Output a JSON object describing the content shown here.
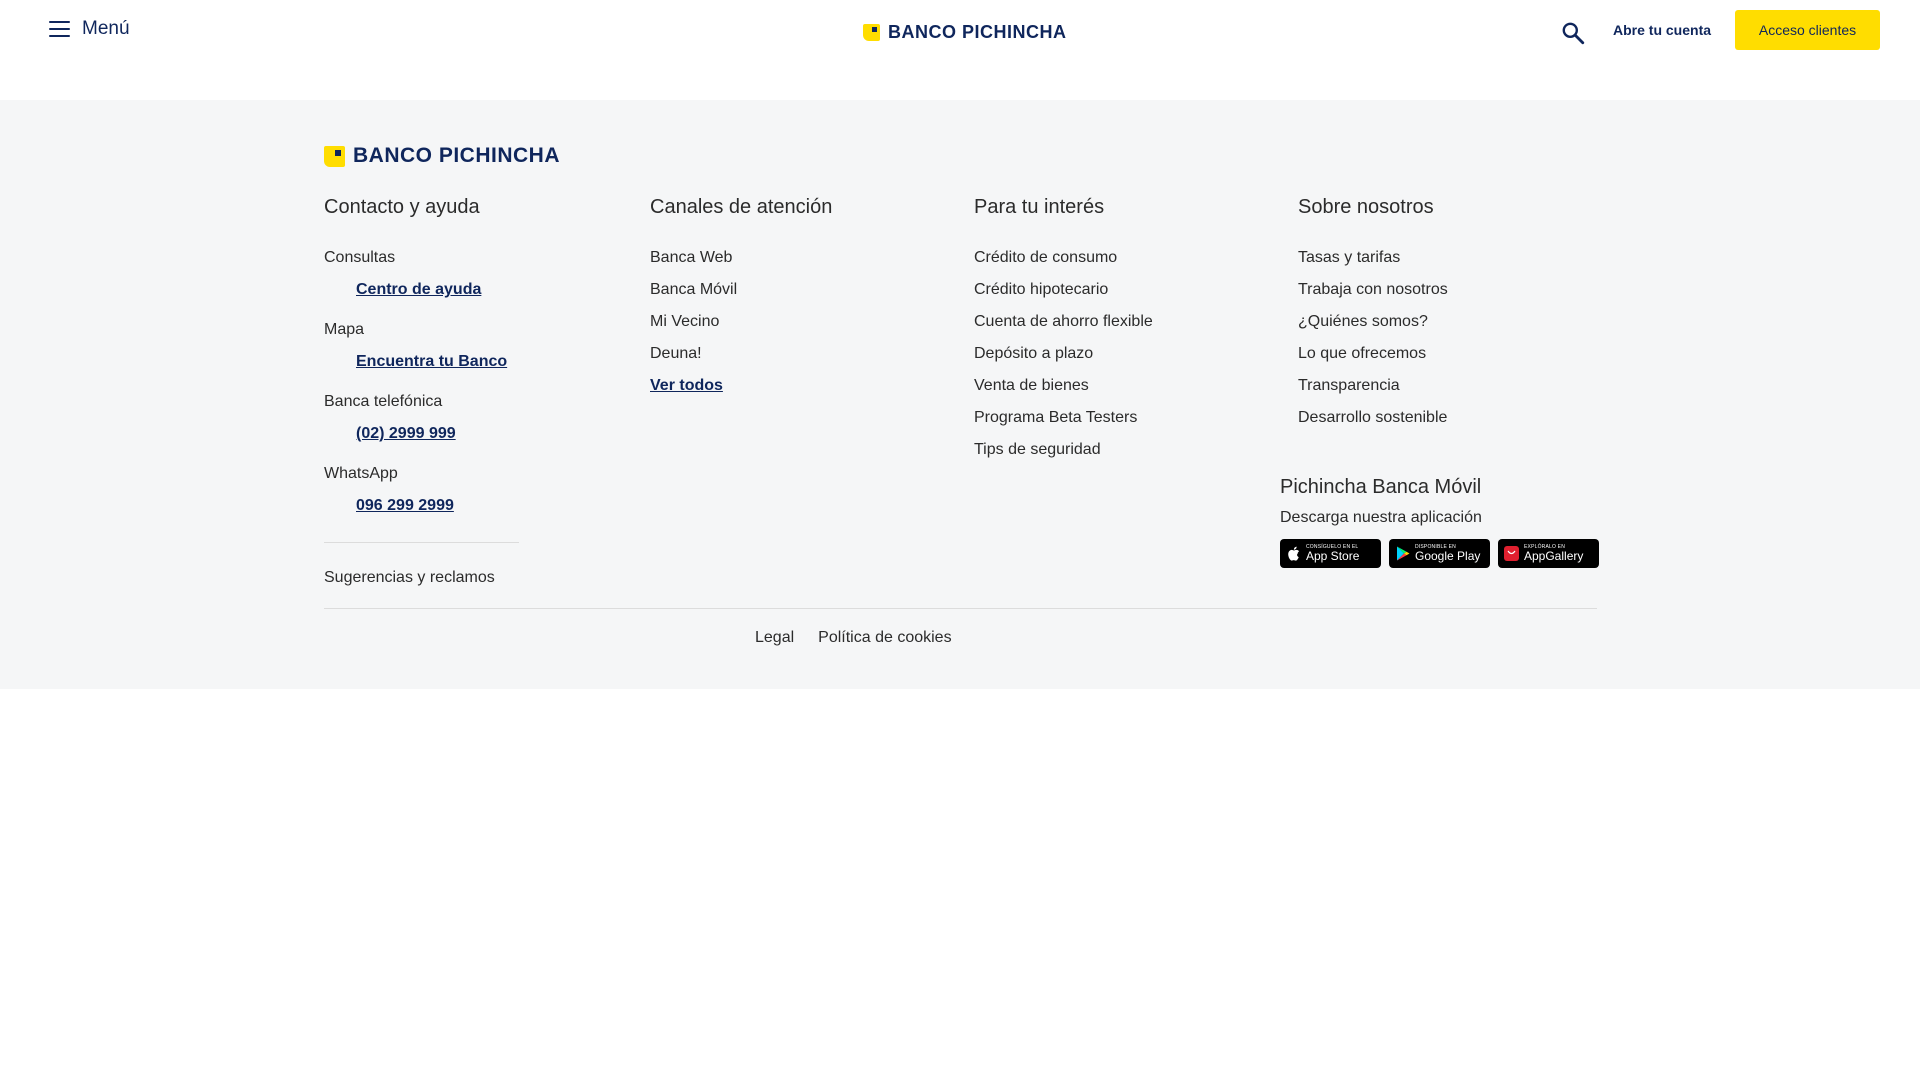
{
  "header": {
    "menu_label": "Menú",
    "logo_text": "BANCO PICHINCHA",
    "open_account": "Abre tu cuenta",
    "access_clients": "Acceso clientes"
  },
  "footer": {
    "logo_text": "BANCO PICHINCHA",
    "contact": {
      "title": "Contacto y ayuda",
      "groups": [
        {
          "label": "Consultas",
          "link": "Centro de ayuda"
        },
        {
          "label": "Mapa",
          "link": "Encuentra tu Banco"
        },
        {
          "label": "Banca telefónica",
          "link": "(02) 2999 999"
        },
        {
          "label": "WhatsApp",
          "link": "096 299 2999"
        }
      ],
      "suggestions": "Sugerencias y reclamos"
    },
    "channels": {
      "title": "Canales de atención",
      "items": [
        "Banca Web",
        "Banca Móvil",
        "Mi Vecino",
        "Deuna!"
      ],
      "see_all": "Ver todos"
    },
    "interest": {
      "title": "Para tu interés",
      "items": [
        "Crédito de consumo",
        "Crédito hipotecario",
        "Cuenta de ahorro flexible",
        "Depósito a plazo",
        "Venta de bienes",
        "Programa Beta Testers",
        "Tips de seguridad"
      ]
    },
    "about": {
      "title": "Sobre nosotros",
      "items": [
        "Tasas y tarifas",
        "Trabaja con nosotros",
        "¿Quiénes somos?",
        "Lo que ofrecemos",
        "Transparencia",
        "Desarrollo sostenible"
      ]
    },
    "app": {
      "title": "Pichincha Banca Móvil",
      "subtitle": "Descarga nuestra aplicación",
      "badges": [
        {
          "small": "Consíguelo en el",
          "big": "App Store",
          "icon": "apple-icon"
        },
        {
          "small": "Disponible en",
          "big": "Google Play",
          "icon": "google-play-icon"
        },
        {
          "small": "Explóralo en",
          "big": "AppGallery",
          "icon": "huawei-icon"
        }
      ]
    },
    "legal": [
      "Legal",
      "Política de cookies"
    ]
  },
  "colors": {
    "brand_navy": "#0f265c",
    "brand_yellow": "#ffdd00",
    "footer_bg": "#f5f6f7"
  }
}
